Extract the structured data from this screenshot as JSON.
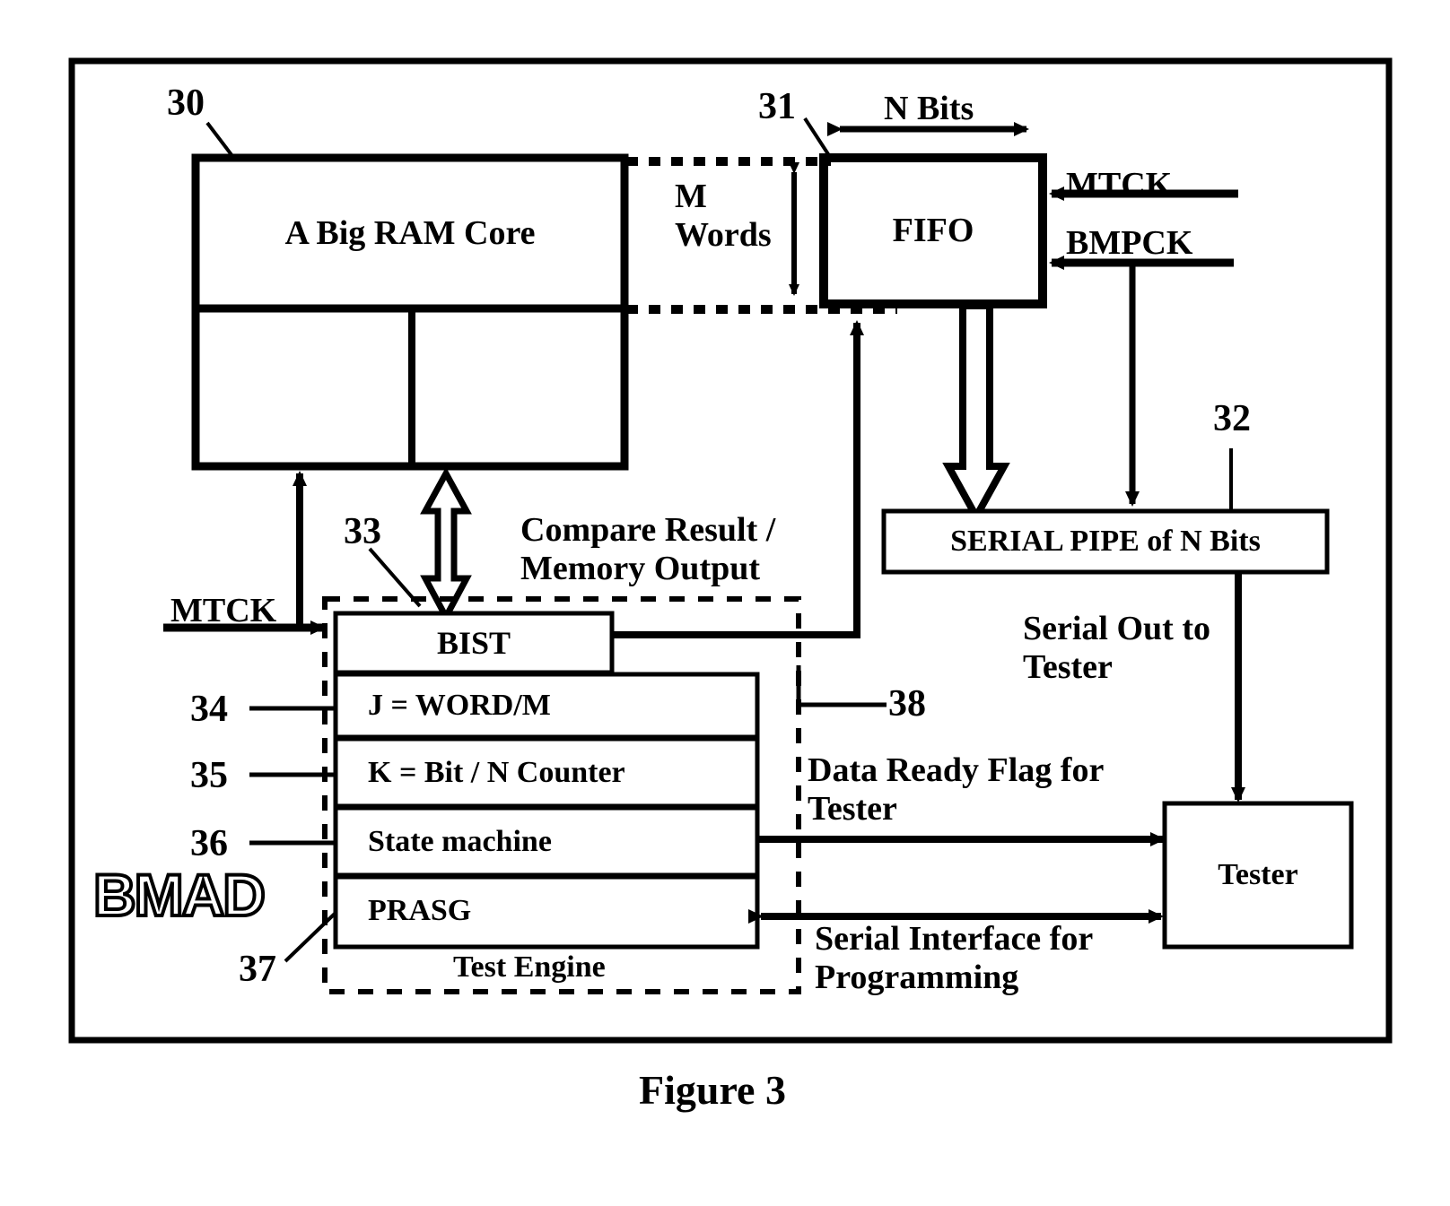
{
  "figure": {
    "caption": "Figure 3"
  },
  "blocks": {
    "ram_core": "A Big RAM Core",
    "fifo": "FIFO",
    "serial_pipe": "SERIAL PIPE of N Bits",
    "tester": "Tester",
    "bist": "BIST",
    "j_counter": "J = WORD/M",
    "k_counter": "K = Bit / N Counter",
    "state_machine": "State machine",
    "prasg": "PRASG",
    "test_engine": "Test Engine",
    "bmad_logo": "BMAD"
  },
  "signals": {
    "n_bits": "N Bits",
    "m_words": "M\nWords",
    "mtck_fifo": "MTCK",
    "bmpck": "BMPCK",
    "mtck_bist": "MTCK",
    "compare_result": "Compare Result /\nMemory Output",
    "serial_out": "Serial Out to\nTester",
    "data_ready": "Data Ready Flag for\nTester",
    "serial_interface": "Serial Interface for\nProgramming"
  },
  "reference_numerals": {
    "ram_core": "30",
    "fifo": "31",
    "serial_pipe": "32",
    "bist": "33",
    "j_counter": "34",
    "k_counter": "35",
    "state_machine": "36",
    "prasg": "37",
    "test_engine": "38"
  },
  "colors": {
    "line": "#000000",
    "background": "#ffffff"
  }
}
